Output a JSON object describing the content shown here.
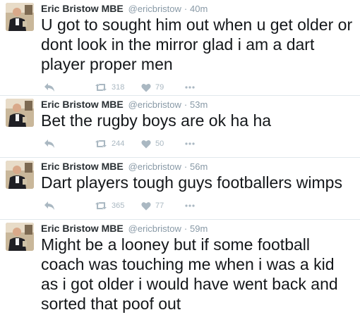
{
  "tweets": [
    {
      "name": "Eric Bristow MBE",
      "handle": "@ericbristow",
      "separator": "·",
      "time": "40m",
      "text": "U got to sought him out when u get older or dont look in the mirror glad i am a dart player proper men",
      "retweets": "318",
      "likes": "79"
    },
    {
      "name": "Eric Bristow MBE",
      "handle": "@ericbristow",
      "separator": "·",
      "time": "53m",
      "text": "Bet the rugby boys are ok ha ha",
      "retweets": "244",
      "likes": "50"
    },
    {
      "name": "Eric Bristow MBE",
      "handle": "@ericbristow",
      "separator": "·",
      "time": "56m",
      "text": "Dart players tough guys footballers wimps",
      "retweets": "365",
      "likes": "77"
    },
    {
      "name": "Eric Bristow MBE",
      "handle": "@ericbristow",
      "separator": "·",
      "time": "59m",
      "text": "Might be a looney but if some football coach was touching me when i was a kid as i got older i would have went back and sorted that poof out",
      "retweets": "",
      "likes": ""
    }
  ],
  "icons": {
    "reply": "reply-icon",
    "retweet": "retweet-icon",
    "like": "heart-icon",
    "more": "more-dots-icon"
  },
  "colors": {
    "name": "#292f33",
    "meta": "#8899a6",
    "action": "#aab8c2",
    "divider": "#e1e8ed"
  }
}
